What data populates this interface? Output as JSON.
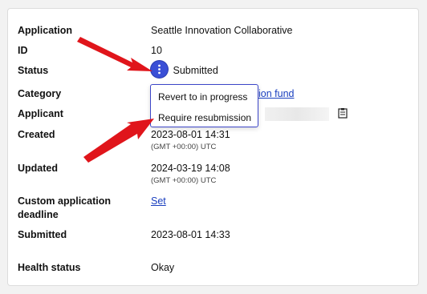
{
  "details": {
    "application": {
      "label": "Application",
      "value": "Seattle Innovation Collaborative"
    },
    "id": {
      "label": "ID",
      "value": "10"
    },
    "status": {
      "label": "Status",
      "value": "Submitted"
    },
    "category": {
      "label": "Category",
      "value": "ion fund"
    },
    "applicant": {
      "label": "Applicant"
    },
    "created": {
      "label": "Created",
      "value": "2023-08-01 14:31",
      "tz": "(GMT +00:00) UTC"
    },
    "updated": {
      "label": "Updated",
      "value": "2024-03-19 14:08",
      "tz": "(GMT +00:00) UTC"
    },
    "deadline": {
      "label": "Custom application deadline",
      "value": "Set"
    },
    "submitted": {
      "label": "Submitted",
      "value": "2023-08-01 14:33"
    },
    "health": {
      "label": "Health status",
      "value": "Okay"
    }
  },
  "status_menu": {
    "items": [
      "Revert to in progress",
      "Require resubmission"
    ]
  },
  "colors": {
    "accent": "#3a4fd6",
    "link": "#1a3fbf",
    "annotation_arrow": "#e0151b"
  },
  "icons": {
    "status_menu": "kebab-vertical-icon",
    "applicant_copy": "copy-icon",
    "annotation": "red-arrow"
  }
}
